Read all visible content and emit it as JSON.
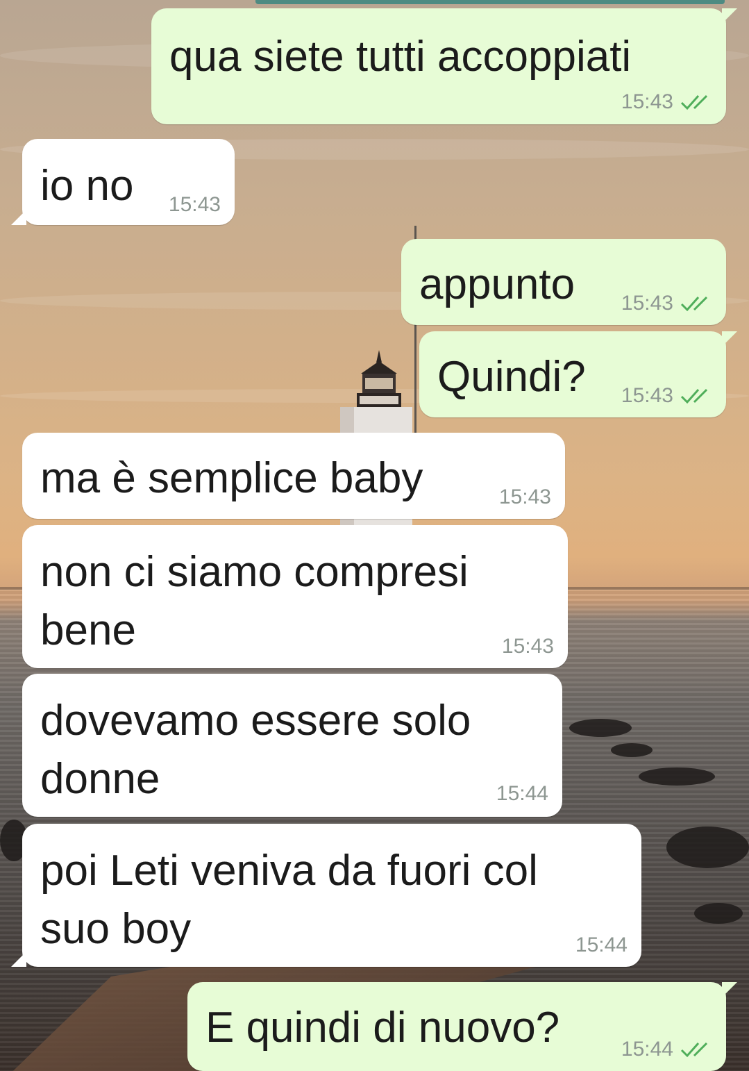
{
  "chat": {
    "messages": [
      {
        "text": "qua siete tutti accoppiati",
        "time": "15:43",
        "direction": "outgoing",
        "status": "read"
      },
      {
        "text": "io no",
        "time": "15:43",
        "direction": "incoming"
      },
      {
        "text": "appunto",
        "time": "15:43",
        "direction": "outgoing",
        "status": "read"
      },
      {
        "text": "Quindi?",
        "time": "15:43",
        "direction": "outgoing",
        "status": "read"
      },
      {
        "text": "ma è semplice baby",
        "time": "15:43",
        "direction": "incoming"
      },
      {
        "text": "non ci siamo compresi\nbene",
        "time": "15:43",
        "direction": "incoming"
      },
      {
        "text": "dovevamo essere solo\ndonne",
        "time": "15:44",
        "direction": "incoming"
      },
      {
        "text": "poi Leti veniva da fuori col\nsuo boy",
        "time": "15:44",
        "direction": "incoming"
      },
      {
        "text": "E quindi di nuovo?",
        "time": "15:44",
        "direction": "outgoing",
        "status": "read"
      }
    ]
  },
  "colors": {
    "outgoing_bubble": "#e7fcd6",
    "incoming_bubble": "#ffffff",
    "read_ticks": "#4fae5a",
    "timestamp": "#8d9691"
  },
  "icons": {
    "read_status": "double-check-icon"
  }
}
